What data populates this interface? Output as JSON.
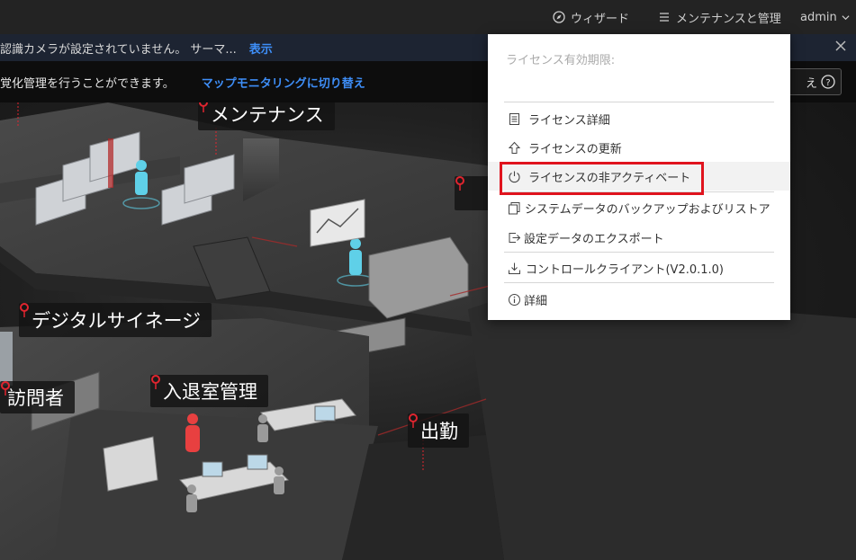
{
  "header": {
    "wizard_label": "ウィザード",
    "maintenance_label": "メンテナンスと管理",
    "user_label": "admin"
  },
  "alert": {
    "text": "認識カメラが設定されていません。 サーマ...",
    "link": "表示"
  },
  "info": {
    "text": "覚化管理を行うことができます。",
    "link": "マップモニタリングに切り替え",
    "button_partial": "え"
  },
  "scene_labels": {
    "maintenance": "メンテナンス",
    "signage": "デジタルサイネージ",
    "visitor": "訪問者",
    "access": "入退室管理",
    "attendance": "出勤"
  },
  "dropdown": {
    "license_expiry_label": "ライセンス有効期限:",
    "items": [
      {
        "label": "ライセンス詳細",
        "icon": "document-icon"
      },
      {
        "label": "ライセンスの更新",
        "icon": "upload-arrow-icon"
      },
      {
        "label": "ライセンスの非アクティベート",
        "icon": "power-icon"
      },
      {
        "label": "システムデータのバックアップおよびリストア",
        "icon": "copy-icon"
      },
      {
        "label": "設定データのエクスポート",
        "icon": "export-icon"
      },
      {
        "label": "コントロールクライアント(V2.0.1.0)",
        "icon": "download-icon"
      },
      {
        "label": "詳細",
        "icon": "info-icon"
      }
    ]
  },
  "colors": {
    "accent_link": "#3e8ef7",
    "highlight": "#e0141e",
    "pin": "#e0252f"
  }
}
